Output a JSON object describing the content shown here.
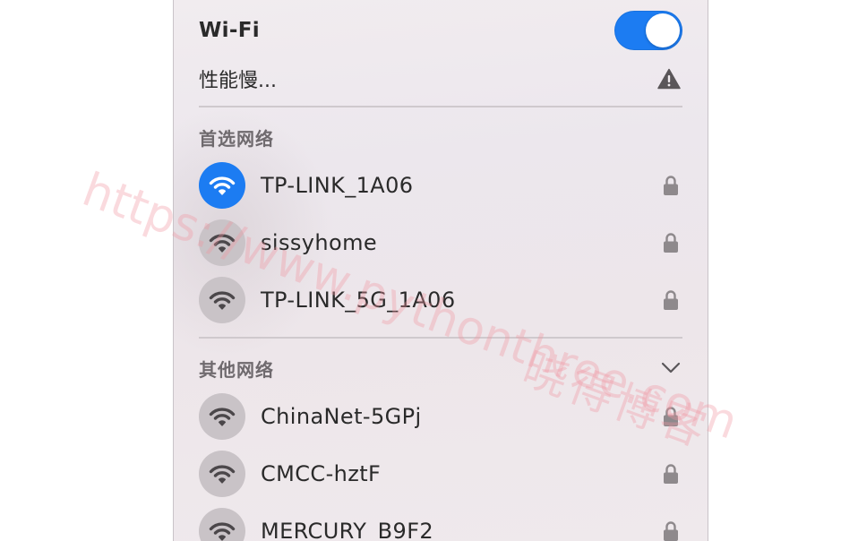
{
  "wifi": {
    "title": "Wi-Fi",
    "enabled": true,
    "status": "性能慢...",
    "status_icon": "warning-icon"
  },
  "preferred": {
    "section_title": "首选网络",
    "networks": [
      {
        "name": "TP-LINK_1A06",
        "connected": true,
        "secured": true
      },
      {
        "name": "sissyhome",
        "connected": false,
        "secured": true
      },
      {
        "name": "TP-LINK_5G_1A06",
        "connected": false,
        "secured": true
      }
    ]
  },
  "other": {
    "section_title": "其他网络",
    "expanded": true,
    "networks": [
      {
        "name": "ChinaNet-5GPj",
        "secured": true
      },
      {
        "name": "CMCC-hztF",
        "secured": true
      },
      {
        "name": "MERCURY_B9F2",
        "secured": true
      }
    ]
  },
  "watermark": {
    "url": "https://www.pythonthree.com",
    "brand": "晓得博客"
  },
  "colors": {
    "accent": "#1c7cf2",
    "inactive_circle": "#c9c3c7"
  }
}
